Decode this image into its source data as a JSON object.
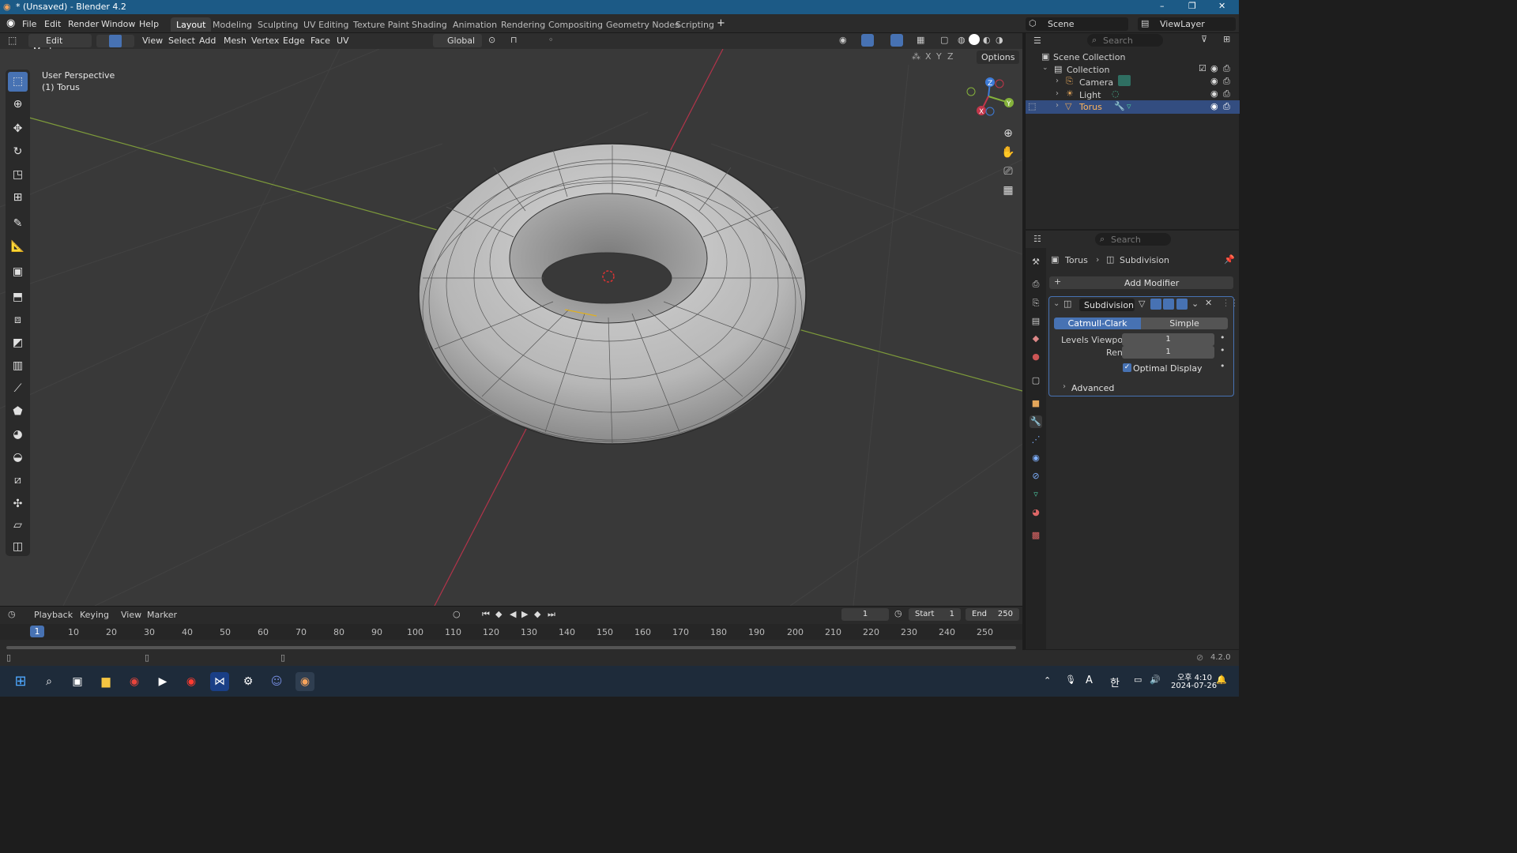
{
  "window": {
    "title": "* (Unsaved) - Blender 4.2",
    "minimize": "–",
    "maximize": "❐",
    "close": "✕"
  },
  "menu": {
    "items": [
      "File",
      "Edit",
      "Render",
      "Window",
      "Help"
    ]
  },
  "workspaces": {
    "tabs": [
      "Layout",
      "Modeling",
      "Sculpting",
      "UV Editing",
      "Texture Paint",
      "Shading",
      "Animation",
      "Rendering",
      "Compositing",
      "Geometry Nodes",
      "Scripting"
    ],
    "active": "Layout",
    "add": "+"
  },
  "topright": {
    "scene": "Scene",
    "view_layer": "ViewLayer"
  },
  "viewport_header": {
    "mode": "Edit Mode",
    "menus": [
      "View",
      "Select",
      "Add",
      "Mesh",
      "Vertex",
      "Edge",
      "Face",
      "UV"
    ],
    "orientation": "Global",
    "axes": [
      "X",
      "Y",
      "Z"
    ],
    "options": "Options"
  },
  "viewport": {
    "perspective": "User Perspective",
    "object": "(1) Torus",
    "gizmo": {
      "x": "X",
      "y": "Y",
      "z": "Z"
    }
  },
  "outliner": {
    "search_placeholder": "Search",
    "scene_collection": "Scene Collection",
    "collection": "Collection",
    "items": [
      {
        "name": "Camera",
        "selected": false
      },
      {
        "name": "Light",
        "selected": false
      },
      {
        "name": "Torus",
        "selected": true
      }
    ]
  },
  "properties": {
    "search_placeholder": "Search",
    "breadcrumb_object": "Torus",
    "breadcrumb_modifier": "Subdivision",
    "add_modifier": "Add Modifier",
    "modifier_name": "Subdivision",
    "type_options": [
      "Catmull-Clark",
      "Simple"
    ],
    "type_selected": "Catmull-Clark",
    "levels_viewport_label": "Levels Viewport",
    "levels_viewport_value": "1",
    "render_label": "Render",
    "render_value": "1",
    "optimal_display_label": "Optimal Display",
    "optimal_display_checked": true,
    "advanced_label": "Advanced"
  },
  "timeline": {
    "menus": [
      "Playback",
      "Keying",
      "View",
      "Marker"
    ],
    "current_frame": "1",
    "start_label": "Start",
    "start_value": "1",
    "end_label": "End",
    "end_value": "250",
    "ruler": [
      "10",
      "20",
      "30",
      "40",
      "50",
      "60",
      "70",
      "80",
      "90",
      "100",
      "110",
      "120",
      "130",
      "140",
      "150",
      "160",
      "170",
      "180",
      "190",
      "200",
      "210",
      "220",
      "230",
      "240",
      "250"
    ],
    "playhead": "1"
  },
  "statusbar": {
    "version": "4.2.0"
  },
  "taskbar": {
    "time": "오후 4:10",
    "date": "2024-07-26",
    "ime_lang": "A",
    "ime_mode": "한"
  },
  "colors": {
    "accent": "#4772b3",
    "x_axis": "#c2364a",
    "y_axis": "#85b23b",
    "z_axis": "#3d7bd8"
  }
}
